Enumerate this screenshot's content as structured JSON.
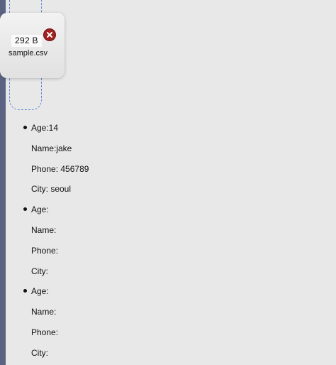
{
  "upload": {
    "file_size": "292 B",
    "file_name": "sample.csv",
    "remove_icon": "close-icon",
    "remove_color": "#a12020"
  },
  "records": [
    {
      "age": "Age:14",
      "name": "Name:jake",
      "phone": "Phone: 456789",
      "city": "City: seoul"
    },
    {
      "age": "Age:",
      "name": "Name:",
      "phone": "Phone:",
      "city": "City:"
    },
    {
      "age": "Age:",
      "name": "Name:",
      "phone": "Phone:",
      "city": "City:"
    }
  ],
  "colors": {
    "background": "#e8e8e8",
    "left_bar": "#5b6383",
    "dropzone_border": "#5b88d6"
  }
}
